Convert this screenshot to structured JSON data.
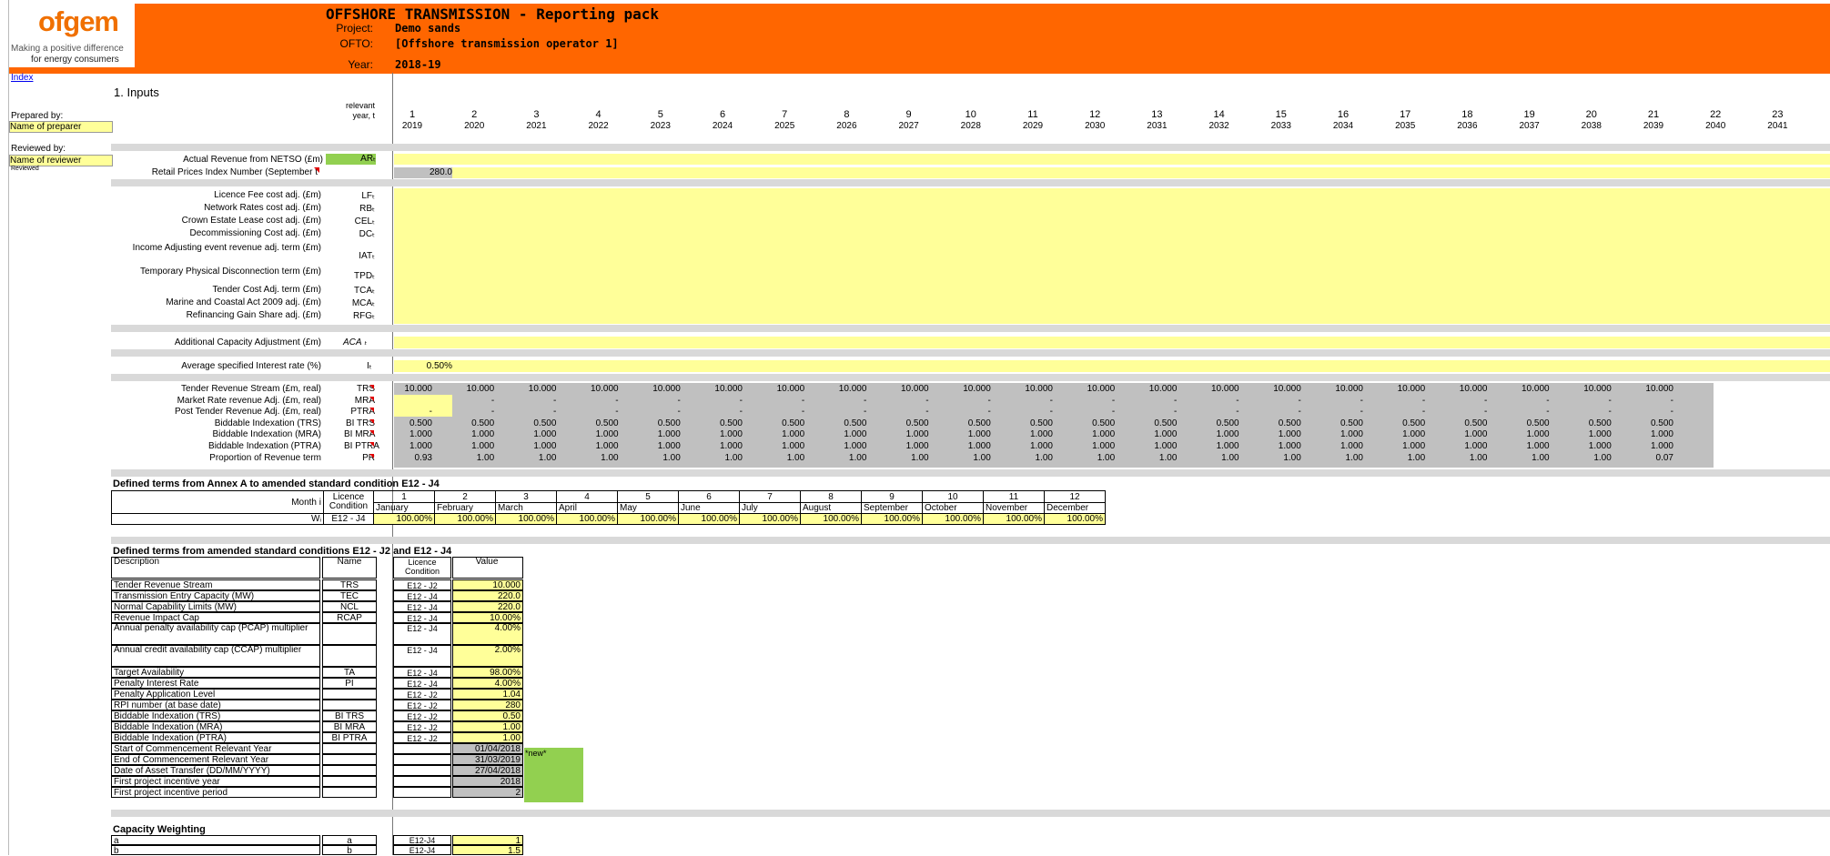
{
  "header": {
    "logo_word": "ofgem",
    "logo_tag1": "Making a positive difference",
    "logo_tag2": "for energy consumers",
    "title": "OFFSHORE TRANSMISSION - Reporting pack",
    "project_label": "Project:",
    "project_value": "Demo sands",
    "ofto_label": "OFTO:",
    "ofto_value": "[Offshore transmission operator 1]",
    "year_label": "Year:",
    "year_value": "2018-19"
  },
  "nav": {
    "index_link": "Index"
  },
  "section": {
    "title": "1. Inputs",
    "relevant_year_label": "relevant year, t"
  },
  "preparer": {
    "prepared_by_label": "Prepared by:",
    "name_of_preparer": "Name of preparer",
    "reviewed_by_label": "Reviewed by:",
    "name_of_reviewer": "Name of reviewer",
    "reviewed_flag": "Reviewed"
  },
  "years": {
    "indices": [
      "1",
      "2",
      "3",
      "4",
      "5",
      "6",
      "7",
      "8",
      "9",
      "10",
      "11",
      "12",
      "13",
      "14",
      "15",
      "16",
      "17",
      "18",
      "19",
      "20",
      "21",
      "22",
      "23"
    ],
    "calendar": [
      "2019",
      "2020",
      "2021",
      "2022",
      "2023",
      "2024",
      "2025",
      "2026",
      "2027",
      "2028",
      "2029",
      "2030",
      "2031",
      "2032",
      "2033",
      "2034",
      "2035",
      "2036",
      "2037",
      "2038",
      "2039",
      "2040",
      "2041"
    ]
  },
  "inputs_top": [
    {
      "label": "Actual Revenue from NETSO (£m)",
      "sym": "ARₜ"
    },
    {
      "label": "Retail Prices Index Number (September t",
      "sym": "",
      "value": "280.0"
    }
  ],
  "adjustments": [
    {
      "label": "Licence Fee cost adj.  (£m)",
      "sym": "LFₜ"
    },
    {
      "label": "Network Rates cost adj.  (£m)",
      "sym": "RBₜ"
    },
    {
      "label": "Crown Estate Lease cost adj.  (£m)",
      "sym": "CELₜ"
    },
    {
      "label": "Decommissioning Cost adj.  (£m)",
      "sym": "DCₜ"
    },
    {
      "label": "Income Adjusting event revenue adj. term  (£m)",
      "sym": "IATₜ"
    },
    {
      "label": "Temporary Physical Disconnection term  (£m)",
      "sym": "TPDₜ"
    },
    {
      "label": "Tender Cost Adj. term (£m)",
      "sym": "TCAₜ"
    },
    {
      "label": "Marine and Coastal Act 2009 adj. (£m)",
      "sym": "MCAₜ"
    },
    {
      "label": "Refinancing Gain Share adj. (£m)",
      "sym": "RFGₜ"
    }
  ],
  "aca": {
    "label": "Additional Capacity Adjustment (£m)",
    "sym": "ACA ₜ"
  },
  "interest": {
    "label": "Average specified Interest rate (%)",
    "sym": "Iₜ",
    "value": "0.50%"
  },
  "revenue_rows": [
    {
      "label": "Tender Revenue Stream (£m, real)",
      "sym": "TRS",
      "values": [
        "10.000",
        "10.000",
        "10.000",
        "10.000",
        "10.000",
        "10.000",
        "10.000",
        "10.000",
        "10.000",
        "10.000",
        "10.000",
        "10.000",
        "10.000",
        "10.000",
        "10.000",
        "10.000",
        "10.000",
        "10.000",
        "10.000",
        "10.000",
        "10.000"
      ]
    },
    {
      "label": "Market Rate revenue Adj. (£m, real)",
      "sym": "MRA",
      "values": [
        "",
        "-",
        "-",
        "-",
        "-",
        "-",
        "-",
        "-",
        "-",
        "-",
        "-",
        "-",
        "-",
        "-",
        "-",
        "-",
        "-",
        "-",
        "-",
        "-",
        "-"
      ]
    },
    {
      "label": "Post Tender Revenue Adj. (£m, real)",
      "sym": "PTRA",
      "values": [
        "-",
        "-",
        "-",
        "-",
        "-",
        "-",
        "-",
        "-",
        "-",
        "-",
        "-",
        "-",
        "-",
        "-",
        "-",
        "-",
        "-",
        "-",
        "-",
        "-",
        "-"
      ]
    },
    {
      "label": "Biddable Indexation (TRS)",
      "sym": "BI TRS",
      "values": [
        "0.500",
        "0.500",
        "0.500",
        "0.500",
        "0.500",
        "0.500",
        "0.500",
        "0.500",
        "0.500",
        "0.500",
        "0.500",
        "0.500",
        "0.500",
        "0.500",
        "0.500",
        "0.500",
        "0.500",
        "0.500",
        "0.500",
        "0.500",
        "0.500"
      ]
    },
    {
      "label": "Biddable Indexation (MRA)",
      "sym": "BI MRA",
      "values": [
        "1.000",
        "1.000",
        "1.000",
        "1.000",
        "1.000",
        "1.000",
        "1.000",
        "1.000",
        "1.000",
        "1.000",
        "1.000",
        "1.000",
        "1.000",
        "1.000",
        "1.000",
        "1.000",
        "1.000",
        "1.000",
        "1.000",
        "1.000",
        "1.000"
      ]
    },
    {
      "label": "Biddable Indexation (PTRA)",
      "sym": "BI PTRA",
      "values": [
        "1.000",
        "1.000",
        "1.000",
        "1.000",
        "1.000",
        "1.000",
        "1.000",
        "1.000",
        "1.000",
        "1.000",
        "1.000",
        "1.000",
        "1.000",
        "1.000",
        "1.000",
        "1.000",
        "1.000",
        "1.000",
        "1.000",
        "1.000",
        "1.000"
      ]
    },
    {
      "label": "Proportion of Revenue term",
      "sym": "PR",
      "values": [
        "0.93",
        "1.00",
        "1.00",
        "1.00",
        "1.00",
        "1.00",
        "1.00",
        "1.00",
        "1.00",
        "1.00",
        "1.00",
        "1.00",
        "1.00",
        "1.00",
        "1.00",
        "1.00",
        "1.00",
        "1.00",
        "1.00",
        "1.00",
        "0.07"
      ]
    }
  ],
  "annex": {
    "title": "Defined terms from Annex A to amended standard condition E12 - J4",
    "month_label": "Month i",
    "licence_label": "Licence Condition",
    "w_label": "Wᵢ",
    "w_cond": "E12 - J4",
    "month_idx": [
      "1",
      "2",
      "3",
      "4",
      "5",
      "6",
      "7",
      "8",
      "9",
      "10",
      "11",
      "12"
    ],
    "months": [
      "January",
      "February",
      "March",
      "April",
      "May",
      "June",
      "July",
      "August",
      "September",
      "October",
      "November",
      "December"
    ],
    "w_values": [
      "100.00%",
      "100.00%",
      "100.00%",
      "100.00%",
      "100.00%",
      "100.00%",
      "100.00%",
      "100.00%",
      "100.00%",
      "100.00%",
      "100.00%",
      "100.00%"
    ]
  },
  "defined": {
    "title": "Defined terms from amended standard conditions E12 - J2 and E12 - J4",
    "col_description": "Description",
    "col_name": "Name",
    "col_licence": "Licence Condition",
    "col_value": "Value",
    "new_note": "*new*",
    "rows": [
      {
        "desc": "Tender Revenue Stream",
        "name": "TRS",
        "cond": "E12 - J2",
        "value": "10.000"
      },
      {
        "desc": "Transmission Entry Capacity (MW)",
        "name": "TEC",
        "cond": "E12 - J4",
        "value": "220.0"
      },
      {
        "desc": "Normal Capability Limits (MW)",
        "name": "NCL",
        "cond": "E12 - J4",
        "value": "220.0"
      },
      {
        "desc": "Revenue Impact Cap",
        "name": "RCAP",
        "cond": "E12 - J4",
        "value": "10.00%"
      },
      {
        "desc": "Annual penalty availability cap (PCAP) multiplier",
        "name": "",
        "cond": "E12 - J4",
        "value": "4.00%"
      },
      {
        "desc": "Annual credit availability cap (CCAP) multiplier",
        "name": "",
        "cond": "E12 - J4",
        "value": "2.00%"
      },
      {
        "desc": "Target Availability",
        "name": "TA",
        "cond": "E12 - J4",
        "value": "98.00%"
      },
      {
        "desc": "Penalty Interest Rate",
        "name": "PI",
        "cond": "E12 - J4",
        "value": "4.00%"
      },
      {
        "desc": "Penalty Application Level",
        "name": "",
        "cond": "E12 - J2",
        "value": "1.04"
      },
      {
        "desc": "RPI number (at base date)",
        "name": "",
        "cond": "E12 - J2",
        "value": "280"
      },
      {
        "desc": "Biddable Indexation (TRS)",
        "name": "BI TRS",
        "cond": "E12 - J2",
        "value": "0.50"
      },
      {
        "desc": "Biddable Indexation (MRA)",
        "name": "BI MRA",
        "cond": "E12 - J2",
        "value": "1.00"
      },
      {
        "desc": "Biddable Indexation (PTRA)",
        "name": "BI PTRA",
        "cond": "E12 - J2",
        "value": "1.00"
      },
      {
        "desc": "Start of Commencement Relevant Year",
        "name": "",
        "cond": "",
        "value": "01/04/2018"
      },
      {
        "desc": "End of Commencement Relevant Year",
        "name": "",
        "cond": "",
        "value": "31/03/2019"
      },
      {
        "desc": "Date of Asset Transfer (DD/MM/YYYY)",
        "name": "",
        "cond": "",
        "value": "27/04/2018"
      },
      {
        "desc": "First project incentive year",
        "name": "",
        "cond": "",
        "value": "2018"
      },
      {
        "desc": "First project incentive period",
        "name": "",
        "cond": "",
        "value": "2"
      }
    ]
  },
  "capacity": {
    "title": "Capacity Weighting",
    "rows": [
      {
        "desc": "a",
        "name": "a",
        "cond": "E12-J4",
        "value": "1"
      },
      {
        "desc": "b",
        "name": "b",
        "cond": "E12-J4",
        "value": "1.5"
      }
    ]
  },
  "colors": {
    "banner": "#ff6600",
    "input_yellow": "#ffff99",
    "calc_grey": "#c0c0c0",
    "flag_green": "#92d050"
  }
}
